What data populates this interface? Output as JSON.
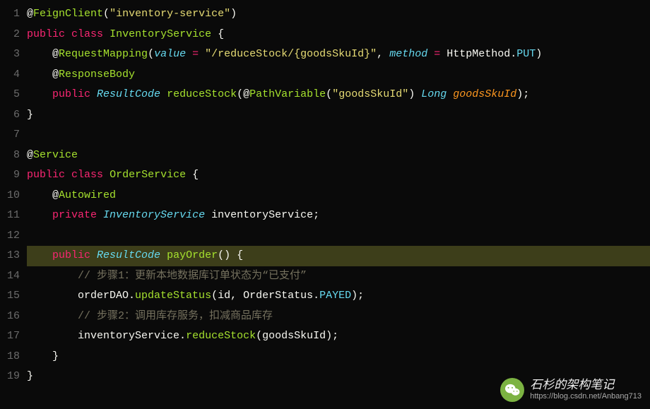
{
  "code": {
    "lines": [
      {
        "n": 1,
        "tokens": [
          {
            "c": "punc",
            "t": "@"
          },
          {
            "c": "fn",
            "t": "FeignClient"
          },
          {
            "c": "punc",
            "t": "("
          },
          {
            "c": "str",
            "t": "\"inventory-service\""
          },
          {
            "c": "punc",
            "t": ")"
          }
        ]
      },
      {
        "n": 2,
        "tokens": [
          {
            "c": "kw",
            "t": "public"
          },
          {
            "c": "punc",
            "t": " "
          },
          {
            "c": "kw",
            "t": "class"
          },
          {
            "c": "punc",
            "t": " "
          },
          {
            "c": "fn",
            "t": "InventoryService"
          },
          {
            "c": "punc",
            "t": " {"
          }
        ]
      },
      {
        "n": 3,
        "indent": 1,
        "tokens": [
          {
            "c": "punc",
            "t": "@"
          },
          {
            "c": "fn",
            "t": "RequestMapping"
          },
          {
            "c": "punc",
            "t": "("
          },
          {
            "c": "type",
            "t": "value "
          },
          {
            "c": "op",
            "t": "="
          },
          {
            "c": "punc",
            "t": " "
          },
          {
            "c": "str",
            "t": "\"/reduceStock/{goodsSkuId}\""
          },
          {
            "c": "punc",
            "t": ", "
          },
          {
            "c": "type",
            "t": "method "
          },
          {
            "c": "op",
            "t": "="
          },
          {
            "c": "punc",
            "t": " "
          },
          {
            "c": "id",
            "t": "HttpMethod"
          },
          {
            "c": "punc",
            "t": "."
          },
          {
            "c": "const",
            "t": "PUT"
          },
          {
            "c": "punc",
            "t": ")"
          }
        ]
      },
      {
        "n": 4,
        "indent": 1,
        "tokens": [
          {
            "c": "punc",
            "t": "@"
          },
          {
            "c": "fn",
            "t": "ResponseBody"
          }
        ]
      },
      {
        "n": 5,
        "indent": 1,
        "tokens": [
          {
            "c": "kw",
            "t": "public"
          },
          {
            "c": "punc",
            "t": " "
          },
          {
            "c": "type",
            "t": "ResultCode"
          },
          {
            "c": "punc",
            "t": " "
          },
          {
            "c": "fn",
            "t": "reduceStock"
          },
          {
            "c": "punc",
            "t": "("
          },
          {
            "c": "punc",
            "t": "@"
          },
          {
            "c": "fn",
            "t": "PathVariable"
          },
          {
            "c": "punc",
            "t": "("
          },
          {
            "c": "str",
            "t": "\"goodsSkuId\""
          },
          {
            "c": "punc",
            "t": ") "
          },
          {
            "c": "type",
            "t": "Long"
          },
          {
            "c": "punc",
            "t": " "
          },
          {
            "c": "var",
            "t": "goodsSkuId"
          },
          {
            "c": "punc",
            "t": ");"
          }
        ]
      },
      {
        "n": 6,
        "tokens": [
          {
            "c": "punc",
            "t": "}"
          }
        ]
      },
      {
        "n": 7,
        "tokens": []
      },
      {
        "n": 8,
        "tokens": [
          {
            "c": "punc",
            "t": "@"
          },
          {
            "c": "fn",
            "t": "Service"
          }
        ]
      },
      {
        "n": 9,
        "tokens": [
          {
            "c": "kw",
            "t": "public"
          },
          {
            "c": "punc",
            "t": " "
          },
          {
            "c": "kw",
            "t": "class"
          },
          {
            "c": "punc",
            "t": " "
          },
          {
            "c": "fn",
            "t": "OrderService"
          },
          {
            "c": "punc",
            "t": " {"
          }
        ]
      },
      {
        "n": 10,
        "indent": 1,
        "tokens": [
          {
            "c": "punc",
            "t": "@"
          },
          {
            "c": "fn",
            "t": "Autowired"
          }
        ]
      },
      {
        "n": 11,
        "indent": 1,
        "tokens": [
          {
            "c": "kw",
            "t": "private"
          },
          {
            "c": "punc",
            "t": " "
          },
          {
            "c": "type",
            "t": "InventoryService"
          },
          {
            "c": "punc",
            "t": " inventoryService;"
          }
        ]
      },
      {
        "n": 12,
        "tokens": []
      },
      {
        "n": 13,
        "indent": 1,
        "highlight": true,
        "tokens": [
          {
            "c": "kw",
            "t": "public"
          },
          {
            "c": "punc",
            "t": " "
          },
          {
            "c": "type",
            "t": "ResultCode"
          },
          {
            "c": "punc",
            "t": " "
          },
          {
            "c": "fn",
            "t": "payOrder"
          },
          {
            "c": "punc",
            "t": "() {"
          }
        ]
      },
      {
        "n": 14,
        "indent": 2,
        "tokens": [
          {
            "c": "comment",
            "t": "// 步骤1：更新本地数据库订单状态为“已支付”"
          }
        ]
      },
      {
        "n": 15,
        "indent": 2,
        "tokens": [
          {
            "c": "id",
            "t": "orderDAO"
          },
          {
            "c": "punc",
            "t": "."
          },
          {
            "c": "fn",
            "t": "updateStatus"
          },
          {
            "c": "punc",
            "t": "(id, "
          },
          {
            "c": "id",
            "t": "OrderStatus"
          },
          {
            "c": "punc",
            "t": "."
          },
          {
            "c": "const",
            "t": "PAYED"
          },
          {
            "c": "punc",
            "t": ");"
          }
        ]
      },
      {
        "n": 16,
        "indent": 2,
        "tokens": [
          {
            "c": "comment",
            "t": "// 步骤2：调用库存服务，扣减商品库存"
          }
        ]
      },
      {
        "n": 17,
        "indent": 2,
        "tokens": [
          {
            "c": "id",
            "t": "inventoryService"
          },
          {
            "c": "punc",
            "t": "."
          },
          {
            "c": "fn",
            "t": "reduceStock"
          },
          {
            "c": "punc",
            "t": "(goodsSkuId);"
          }
        ]
      },
      {
        "n": 18,
        "indent": 1,
        "tokens": [
          {
            "c": "punc",
            "t": "}"
          }
        ]
      },
      {
        "n": 19,
        "tokens": [
          {
            "c": "punc",
            "t": "}"
          }
        ]
      }
    ]
  },
  "watermark": {
    "title": "石杉的架构笔记",
    "url": "https://blog.csdn.net/Anbang713",
    "icon": "wechat-icon"
  }
}
